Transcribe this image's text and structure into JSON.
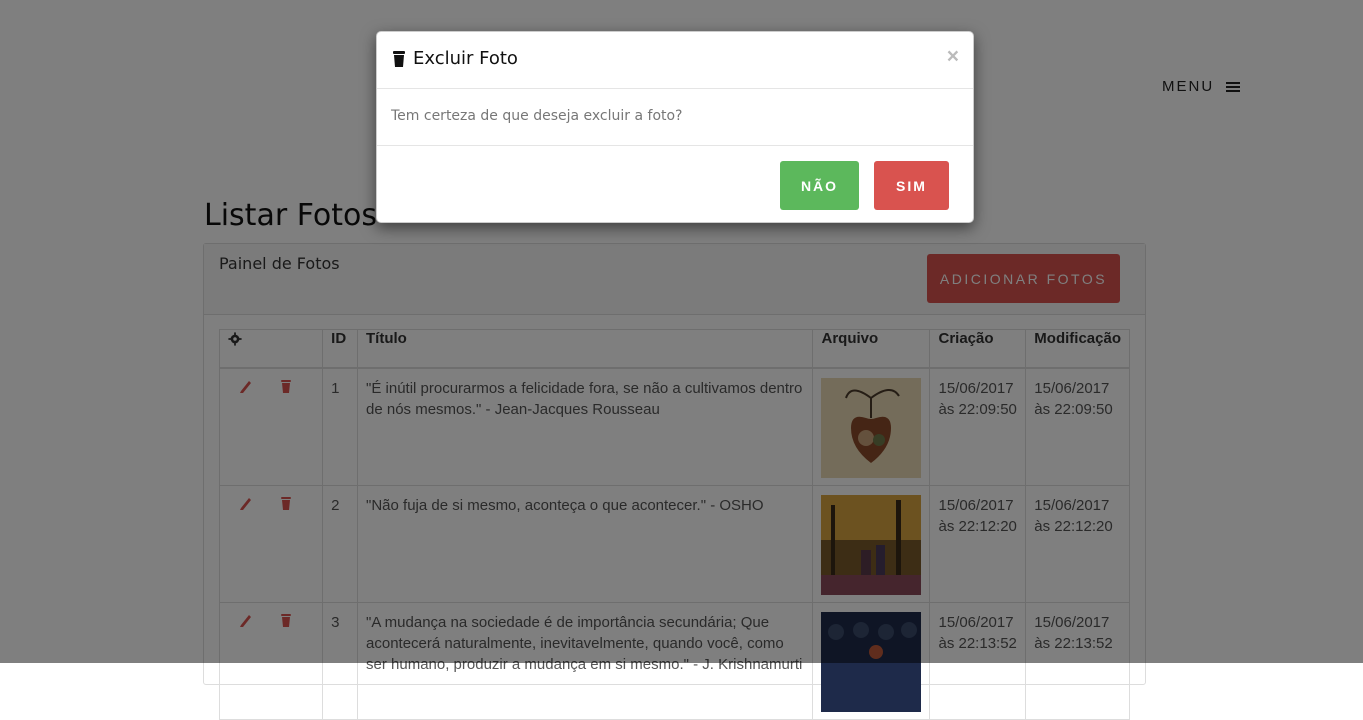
{
  "nav": {
    "menu_label": "MENU"
  },
  "page": {
    "title": "Listar Fotos"
  },
  "panel": {
    "title": "Painel de Fotos",
    "add_button": "ADICIONAR FOTOS"
  },
  "table": {
    "headers": {
      "id": "ID",
      "title": "Título",
      "file": "Arquivo",
      "created": "Criação",
      "modified": "Modificação"
    },
    "rows": [
      {
        "id": "1",
        "title": "\"É inútil procurarmos a felicidade fora, se não a cultivamos dentro de nós mesmos.\" - Jean-Jacques Rousseau",
        "created": "15/06/2017 às 22:09:50",
        "modified": "15/06/2017 às 22:09:50"
      },
      {
        "id": "2",
        "title": "\"Não fuja de si mesmo, aconteça o que acontecer.\" - OSHO",
        "created": "15/06/2017 às 22:12:20",
        "modified": "15/06/2017 às 22:12:20"
      },
      {
        "id": "3",
        "title": "\"A mudança na sociedade é de importância secundária; Que acontecerá naturalmente, inevitavelmente, quando você, como ser humano, produzir a mudança em si mesmo.\" - J. Krishnamurti",
        "created": "15/06/2017 às 22:13:52",
        "modified": "15/06/2017 às 22:13:52"
      }
    ]
  },
  "modal": {
    "title": "Excluir Foto",
    "close": "×",
    "message": "Tem certeza de que deseja excluir a foto?",
    "no_button": "NÃO",
    "yes_button": "SIM"
  },
  "colors": {
    "danger": "#d9534f",
    "success": "#5cb85c",
    "overlay": "rgba(0,0,0,0.5)"
  }
}
